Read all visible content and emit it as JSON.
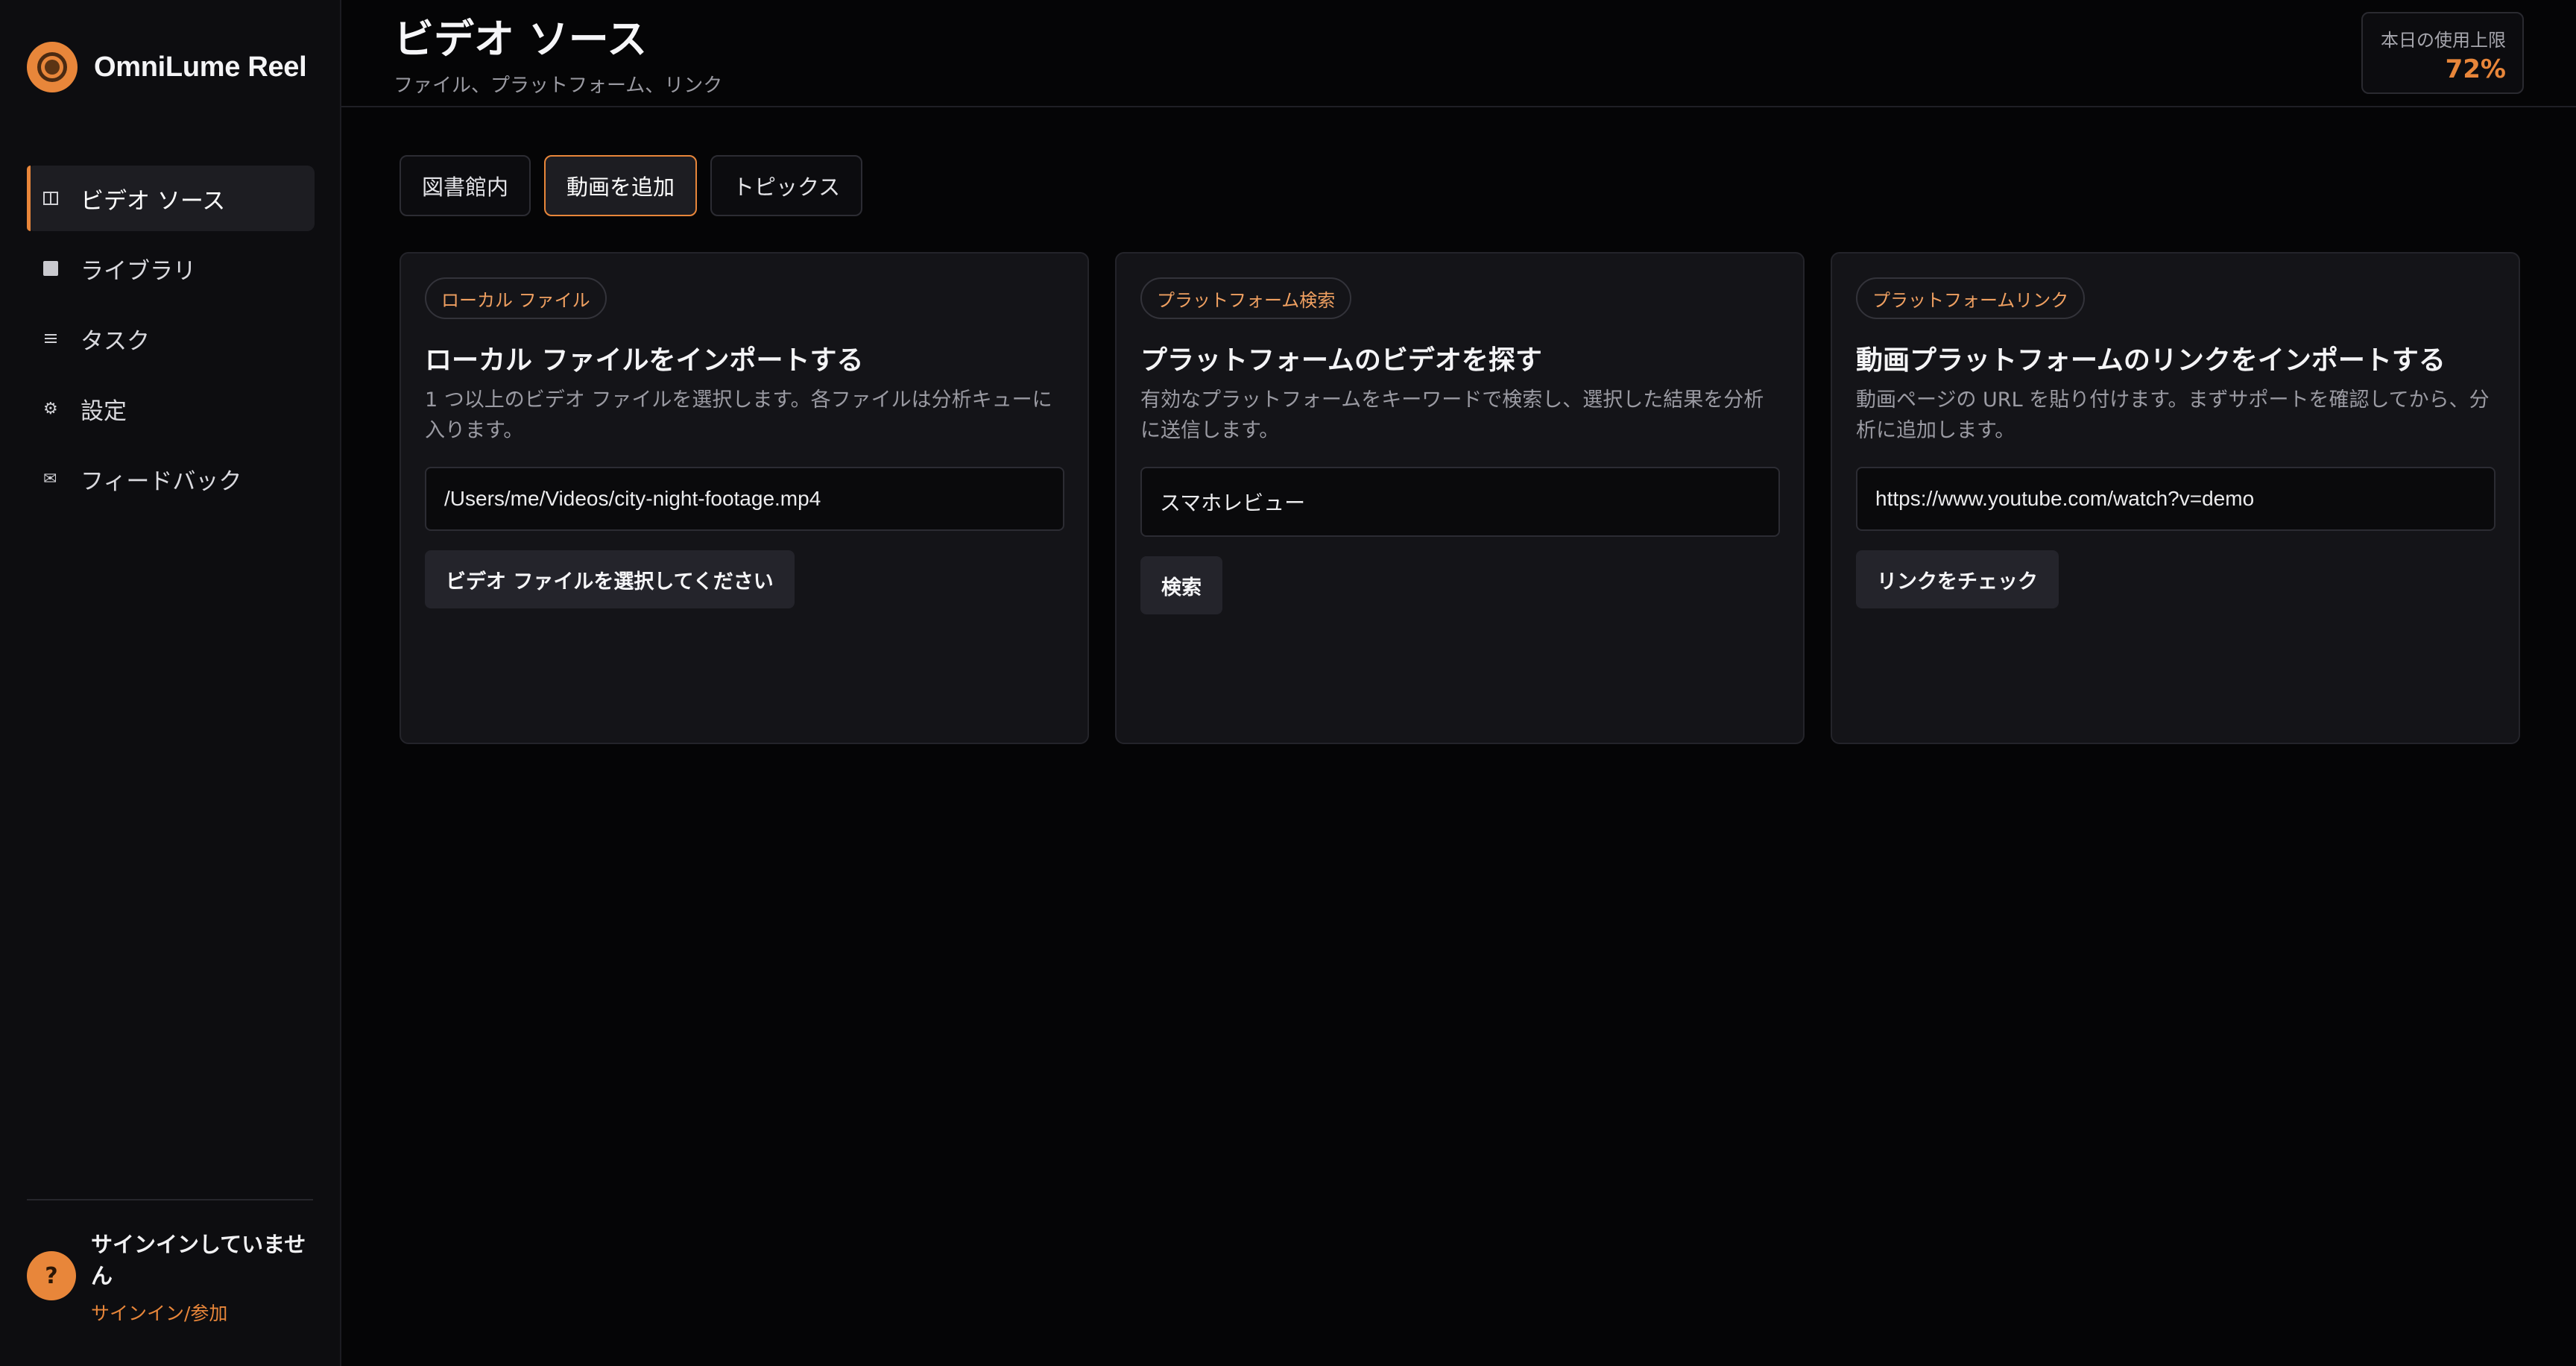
{
  "app": {
    "name": "OmniLume Reel"
  },
  "colors": {
    "accent": "#e8863a",
    "background": "#050506",
    "panel": "#141418"
  },
  "sidebar": {
    "items": [
      {
        "label": "ビデオ ソース",
        "icon": "columns-icon",
        "active": true
      },
      {
        "label": "ライブラリ",
        "icon": "square-icon",
        "active": false
      },
      {
        "label": "タスク",
        "icon": "list-icon",
        "active": false
      },
      {
        "label": "設定",
        "icon": "gear-icon",
        "active": false
      },
      {
        "label": "フィードバック",
        "icon": "mail-icon",
        "active": false
      }
    ],
    "user": {
      "avatar_glyph": "?",
      "status": "サインインしていません",
      "link": "サインイン/参加"
    }
  },
  "header": {
    "title": "ビデオ ソース",
    "subtitle": "ファイル、プラットフォーム、リンク",
    "usage": {
      "label": "本日の使用上限",
      "value": "72%"
    }
  },
  "tabs": [
    {
      "label": "図書館内",
      "active": false
    },
    {
      "label": "動画を追加",
      "active": true
    },
    {
      "label": "トピックス",
      "active": false
    }
  ],
  "cards": [
    {
      "tag": "ローカル ファイル",
      "title": "ローカル ファイルをインポートする",
      "description": "1 つ以上のビデオ ファイルを選択します。各ファイルは分析キューに入ります。",
      "input_value": "/Users/me/Videos/city-night-footage.mp4",
      "button": "ビデオ ファイルを選択してください"
    },
    {
      "tag": "プラットフォーム検索",
      "title": "プラットフォームのビデオを探す",
      "description": "有効なプラットフォームをキーワードで検索し、選択した結果を分析に送信します。",
      "input_value": "スマホレビュー",
      "button": "検索"
    },
    {
      "tag": "プラットフォームリンク",
      "title": "動画プラットフォームのリンクをインポートする",
      "description": "動画ページの URL を貼り付けます。まずサポートを確認してから、分析に追加します。",
      "input_value": "https://www.youtube.com/watch?v=demo",
      "button": "リンクをチェック"
    }
  ]
}
